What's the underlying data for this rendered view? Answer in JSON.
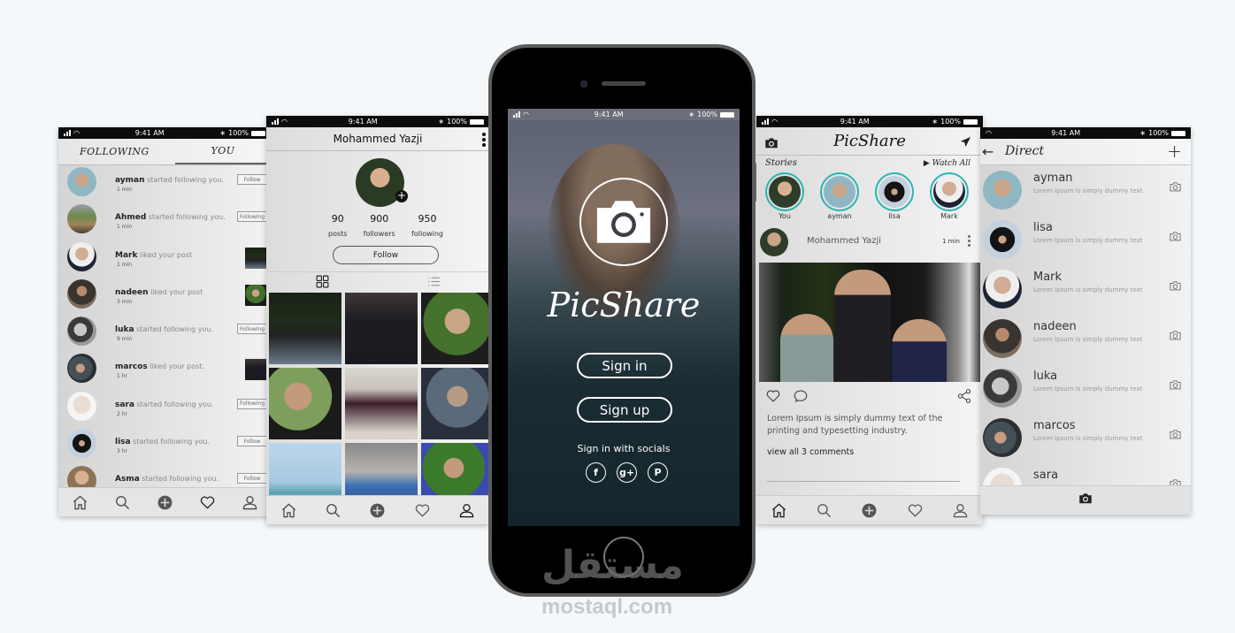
{
  "status_bar": {
    "time": "9:41 AM",
    "battery": "100%"
  },
  "activity_screen": {
    "tabs": [
      {
        "label": "FOLLOWING",
        "active": false
      },
      {
        "label": "YOU",
        "active": true
      }
    ],
    "items": [
      {
        "user": "ayman",
        "action": "started following you.",
        "time": "1 min",
        "button": "Follow",
        "avatar": "c-ayman"
      },
      {
        "user": "Ahmed",
        "action": "started following you.",
        "time": "1 min",
        "button": "Following",
        "avatar": "c-ahmed"
      },
      {
        "user": "Mark",
        "action": "liked your post",
        "time": "1 min",
        "thumb": "g1",
        "avatar": "c-mark"
      },
      {
        "user": "nadeen",
        "action": "liked your post",
        "time": "3 min",
        "thumb": "g3",
        "avatar": "c-nadeen"
      },
      {
        "user": "luka",
        "action": "started following you.",
        "time": "9 min",
        "button": "Following",
        "avatar": "c-luka"
      },
      {
        "user": "marcos",
        "action": "liked your post.",
        "time": "1 hr",
        "thumb": "g2",
        "avatar": "c-marcos"
      },
      {
        "user": "sara",
        "action": "started following you.",
        "time": "2 hr",
        "button": "Following",
        "avatar": "c-sara"
      },
      {
        "user": "lisa",
        "action": "started following you.",
        "time": "3 hr",
        "button": "Follow",
        "avatar": "c-lisa"
      },
      {
        "user": "Asma",
        "action": "started following you.",
        "time": "",
        "button": "Follow",
        "avatar": "c-asma"
      }
    ]
  },
  "profile_screen": {
    "name": "Mohammed Yazji",
    "stats": [
      {
        "value": "90",
        "label": "posts"
      },
      {
        "value": "900",
        "label": "followers"
      },
      {
        "value": "950",
        "label": "following"
      }
    ],
    "follow_label": "Follow",
    "add_icon": "+"
  },
  "login_screen": {
    "brand": "PicShare",
    "sign_in_label": "Sign in",
    "sign_up_label": "Sign up",
    "socials_label": "Sign in with socials",
    "socials": [
      {
        "name": "facebook",
        "glyph": "f"
      },
      {
        "name": "google-plus",
        "glyph": "g+"
      },
      {
        "name": "pinterest",
        "glyph": "P"
      }
    ]
  },
  "feed_screen": {
    "brand": "PicShare",
    "stories_label": "Stories",
    "watch_all_label": "▶ Watch All",
    "stories": [
      {
        "name": "You",
        "avatar": "c-you"
      },
      {
        "name": "ayman",
        "avatar": "c-ayman"
      },
      {
        "name": "lisa",
        "avatar": "c-lisa"
      },
      {
        "name": "Mark",
        "avatar": "c-mark"
      }
    ],
    "post": {
      "author": "Mohammed Yazji",
      "time": "1 min",
      "caption": "Lorem Ipsum is simply dummy text of the printing and typesetting industry.",
      "comments_link": "view all 3 comments"
    },
    "accent_color": "#2ab3b3"
  },
  "direct_screen": {
    "title": "Direct",
    "back_glyph": "←",
    "new_glyph": "+",
    "items": [
      {
        "name": "ayman",
        "message": "Lorem Ipsum is simply dummy text",
        "avatar": "c-ayman"
      },
      {
        "name": "lisa",
        "message": "Lorem Ipsum is simply dummy text",
        "avatar": "c-lisa"
      },
      {
        "name": "Mark",
        "message": "Lorem Ipsum is simply dummy text",
        "avatar": "c-mark"
      },
      {
        "name": "nadeen",
        "message": "Lorem Ipsum is simply dummy text",
        "avatar": "c-nadeen"
      },
      {
        "name": "luka",
        "message": "Lorem Ipsum is simply dummy text",
        "avatar": "c-luka"
      },
      {
        "name": "marcos",
        "message": "Lorem Ipsum is simply dummy text",
        "avatar": "c-marcos"
      },
      {
        "name": "sara",
        "message": "",
        "avatar": "c-sara"
      }
    ]
  },
  "watermark": {
    "arabic": "مستقل",
    "latin": "mostaql.com"
  }
}
